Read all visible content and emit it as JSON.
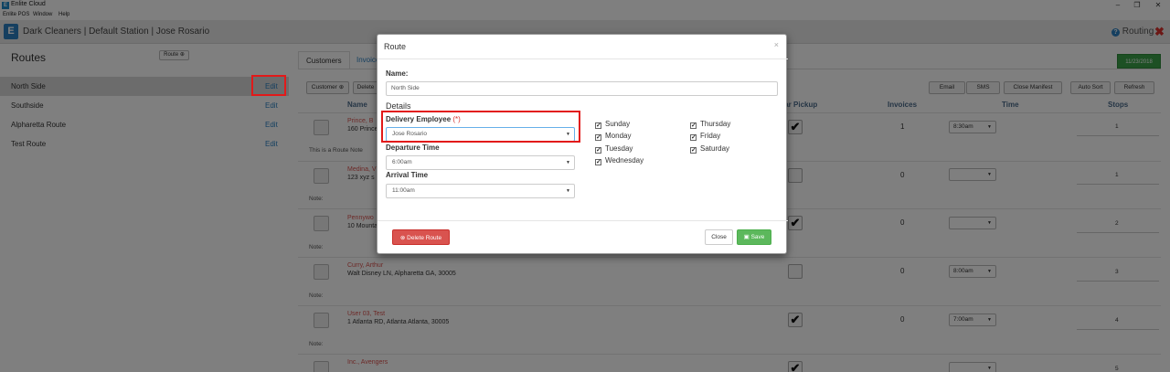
{
  "os": {
    "app_title": "Enlite Cloud",
    "logo_letter": "E",
    "menu": [
      "Enlite POS",
      "Window",
      "Help"
    ],
    "controls": [
      "–",
      "❐",
      "✕"
    ]
  },
  "header": {
    "logo_letter": "E",
    "title": "Dark Cleaners | Default Station | Jose Rosario",
    "routing_label": "Routing",
    "help_icon": "?",
    "close_icon": "✖"
  },
  "left": {
    "title": "Routes",
    "route_button": "Route ⊕",
    "routes": [
      {
        "name": "North Side",
        "edit": "Edit"
      },
      {
        "name": "Southside",
        "edit": "Edit"
      },
      {
        "name": "Alpharetta Route",
        "edit": "Edit"
      },
      {
        "name": "Test Route",
        "edit": "Edit"
      }
    ]
  },
  "main": {
    "tabs": [
      "Customers",
      "Invoices"
    ],
    "date": "11/23/2018",
    "toolbar": {
      "customer": "Customer ⊕",
      "delete": "Delete",
      "email": "Email",
      "sms": "SMS",
      "close_manifest": "Close Manifest",
      "auto_sort": "Auto Sort",
      "refresh": "Refresh"
    },
    "columns": {
      "name": "Name",
      "pickup": "lar Pickup",
      "invoices": "Invoices",
      "time": "Time",
      "stops": "Stops"
    },
    "rows": [
      {
        "name": "Prince, B",
        "address": "160 Prince",
        "note": "This is a Route Note",
        "invoices": "1",
        "time": "8:30am",
        "stop": "1",
        "pickup": "✔"
      },
      {
        "name": "Medina, V",
        "address": "123 xyz s",
        "note": "Note:",
        "invoices": "0",
        "time": "",
        "stop": "1",
        "pickup": ""
      },
      {
        "name": "Pennywo",
        "address": "10 Mounta",
        "note": "Note:",
        "invoices": "0",
        "time": "",
        "stop": "2",
        "pickup": "✔"
      },
      {
        "name": "Curry, Arthur",
        "address": "Walt Disney LN, Alpharetta GA, 30005",
        "note": "Note:",
        "invoices": "0",
        "time": "8:00am",
        "stop": "3",
        "pickup": ""
      },
      {
        "name": "User 03, Test",
        "address": "1 Atlanta RD, Atlanta Atlanta, 30005",
        "note": "Note:",
        "invoices": "0",
        "time": "7:00am",
        "stop": "4",
        "pickup": "✔"
      },
      {
        "name": "Inc., Avengers",
        "address": "",
        "note": "",
        "invoices": "0",
        "time": "",
        "stop": "5",
        "pickup": "✔"
      }
    ]
  },
  "modal": {
    "title": "Route",
    "close": "×",
    "name_label": "Name:",
    "name_value": "North Side",
    "details_label": "Details",
    "delivery_label": "Delivery Employee",
    "required_mark": "(*)",
    "delivery_value": "Jose Rosario",
    "departure_label": "Departure Time",
    "departure_value": "6:00am",
    "arrival_label": "Arrival Time",
    "arrival_value": "11:00am",
    "days": [
      {
        "name": "Sunday",
        "checked": true
      },
      {
        "name": "Monday",
        "checked": true
      },
      {
        "name": "Tuesday",
        "checked": true
      },
      {
        "name": "Wednesday",
        "checked": true
      },
      {
        "name": "Thursday",
        "checked": true
      },
      {
        "name": "Friday",
        "checked": true
      },
      {
        "name": "Saturday",
        "checked": true
      }
    ],
    "delete_button": "⊗ Delete Route",
    "close_button": "Close",
    "save_button": "Save"
  },
  "colors": {
    "accent": "#2a7fc0",
    "danger": "#d9534f",
    "success": "#5cb85c",
    "highlight": "#e21a1a"
  }
}
